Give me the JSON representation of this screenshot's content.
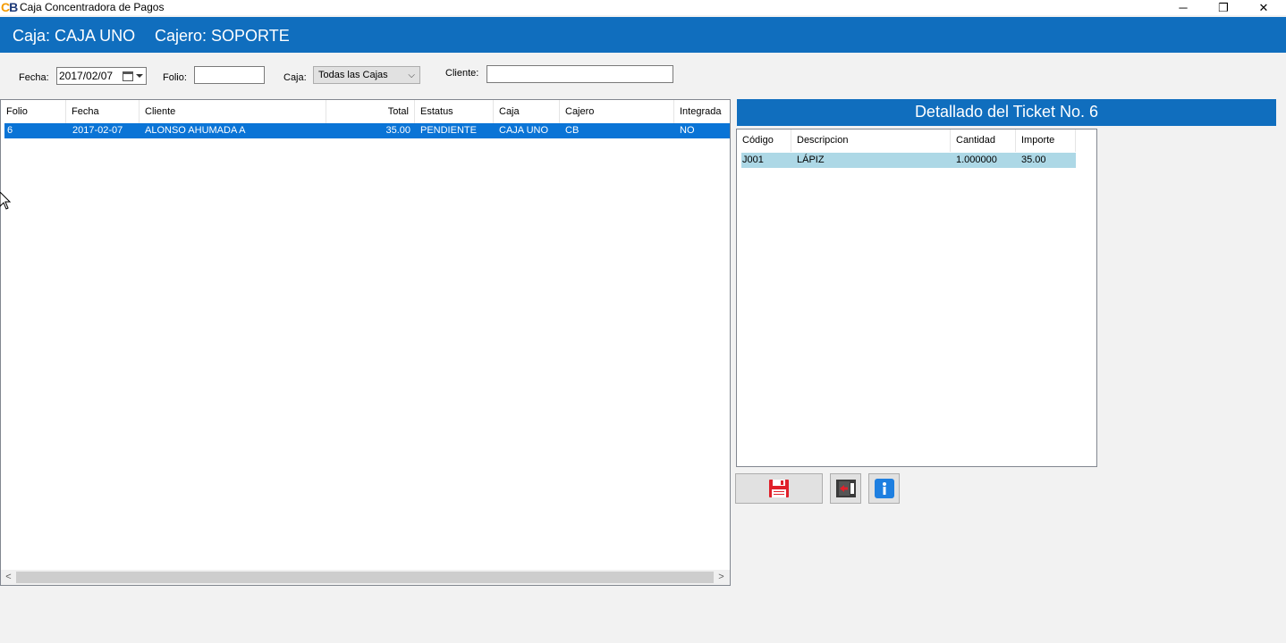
{
  "window": {
    "logo_c": "C",
    "logo_b": "B",
    "title": "Caja Concentradora de Pagos",
    "controls": {
      "minimize": "─",
      "restore": "❐",
      "close": "✕"
    }
  },
  "header": {
    "caja_label": "Caja:",
    "caja_value": "CAJA UNO",
    "cajero_label": "Cajero:",
    "cajero_value": "SOPORTE",
    "color": "#106ebe"
  },
  "filters": {
    "fecha_label": "Fecha:",
    "fecha_value": "2017/02/07",
    "folio_label": "Folio:",
    "folio_value": "",
    "caja_label": "Caja:",
    "caja_selected": "Todas las Cajas",
    "cliente_label": "Cliente:",
    "cliente_value": ""
  },
  "tickets": {
    "columns": [
      "Folio",
      "Fecha",
      "Cliente",
      "Total",
      "Estatus",
      "Caja",
      "Cajero",
      "Integrada"
    ],
    "rows": [
      [
        "6",
        "2017-02-07",
        "ALONSO AHUMADA A",
        "35.00",
        "PENDIENTE",
        "CAJA UNO",
        "CB",
        "NO"
      ]
    ],
    "selected_color": "#0a74d6"
  },
  "detail": {
    "title": "Detallado del Ticket No. 6",
    "columns": [
      "Código",
      "Descripcion",
      "Cantidad",
      "Importe"
    ],
    "rows": [
      [
        "J001",
        "LÁPIZ",
        "1.000000",
        "35.00"
      ]
    ],
    "row_color": "#add8e6"
  },
  "actions": {
    "save_icon": "floppy-disk-icon",
    "exit_icon": "exit-door-icon",
    "info_icon": "info-icon"
  },
  "scrollbar": {
    "left_arrow": "<",
    "right_arrow": ">"
  }
}
